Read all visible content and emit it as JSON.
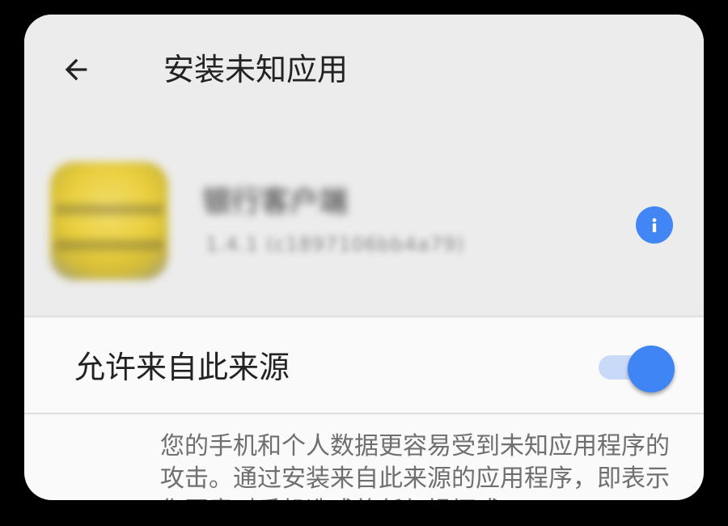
{
  "appbar": {
    "title": "安装未知应用",
    "back_icon": "arrow-left-icon"
  },
  "app": {
    "name": "银行客户端",
    "version": "1.4.1 (c1897106bb4a79)",
    "info_icon": "info-icon"
  },
  "setting": {
    "label": "允许来自此来源",
    "enabled": true
  },
  "description": "您的手机和个人数据更容易受到未知应用程序的攻击。通过安装来自此来源的应用程序，即表示您同意对手机造成的任何损坏或",
  "colors": {
    "accent": "#4285f4",
    "switch_track": "#c8daf8",
    "header_bg": "#ececec",
    "content_bg": "#fafafa"
  }
}
